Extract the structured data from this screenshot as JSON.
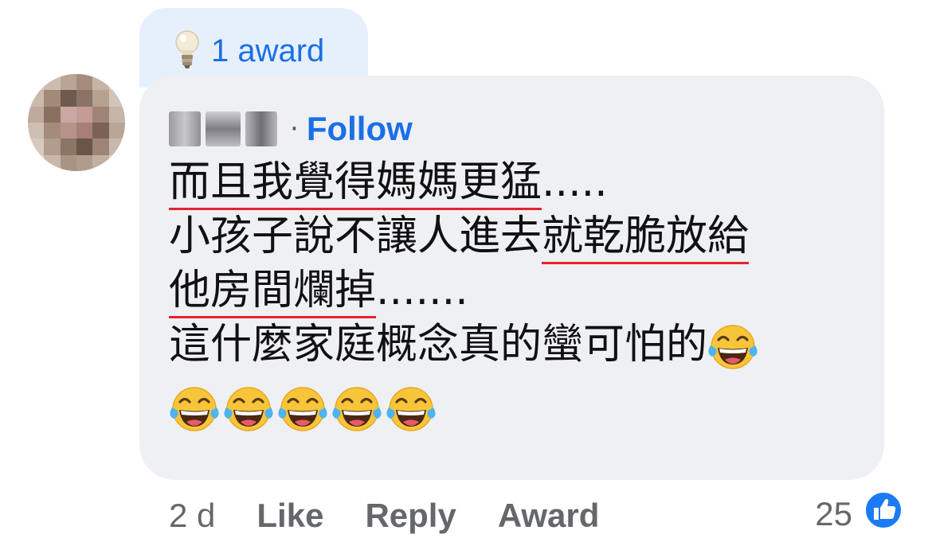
{
  "award": {
    "count_label": "1 award",
    "icon": "lightbulb-icon"
  },
  "comment": {
    "author": {
      "name": "",
      "avatar": "blurred-avatar"
    },
    "follow_label": "Follow",
    "separator": "·",
    "lines": {
      "l1_underlined": "而且我覺得媽媽更猛",
      "l1_rest": ".....",
      "l2_plain": "小孩子說不讓人進去",
      "l2_underlined": "就乾脆放給",
      "l3_underlined": "他房間爛掉",
      "l3_rest": ".......",
      "l4": "這什麼家庭概念真的蠻可怕的"
    },
    "emojis": [
      "laughing-with-tears",
      "laughing-with-tears",
      "laughing-with-tears",
      "laughing-with-tears",
      "laughing-with-tears",
      "laughing-with-tears"
    ]
  },
  "footer": {
    "time": "2 d",
    "like_label": "Like",
    "reply_label": "Reply",
    "award_label": "Award",
    "reaction_count": "25",
    "reaction_icon": "thumbs-up-icon"
  },
  "colors": {
    "accent_blue": "#1b6fe6",
    "bubble_bg": "#eff0f4",
    "award_tab_bg": "#e6f0fd",
    "underline_red": "#e3242b",
    "meta_gray": "#65676b"
  }
}
